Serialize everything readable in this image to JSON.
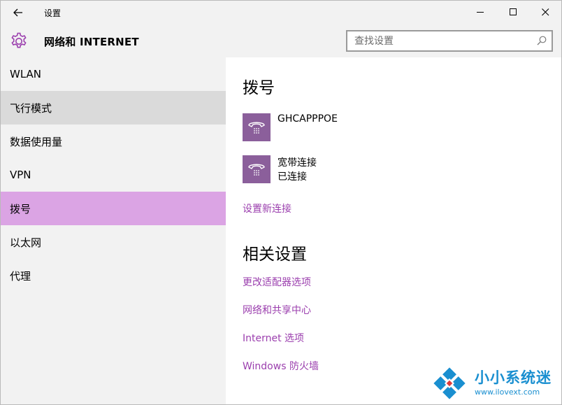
{
  "window": {
    "title": "设置",
    "minimize_icon": "minimize-icon",
    "maximize_icon": "maximize-icon",
    "close_icon": "close-icon"
  },
  "header": {
    "section_title": "网络和 INTERNET",
    "search_placeholder": "查找设置"
  },
  "sidebar": {
    "items": [
      {
        "label": "WLAN"
      },
      {
        "label": "飞行模式"
      },
      {
        "label": "数据使用量"
      },
      {
        "label": "VPN"
      },
      {
        "label": "拨号"
      },
      {
        "label": "以太网"
      },
      {
        "label": "代理"
      }
    ],
    "active_index": 4,
    "hover_index": 1
  },
  "main": {
    "dialup_heading": "拨号",
    "connections": [
      {
        "name": "GHCAPPPOE",
        "status": ""
      },
      {
        "name": "宽带连接",
        "status": "已连接"
      }
    ],
    "new_connection_link": "设置新连接",
    "related_heading": "相关设置",
    "related_links": [
      "更改适配器选项",
      "网络和共享中心",
      "Internet 选项",
      "Windows 防火墙"
    ]
  },
  "watermark": {
    "text": "小小系统迷",
    "url": "www.ilovext.com"
  },
  "colors": {
    "accent": "#9b3fae",
    "active_nav": "#dba4e4",
    "icon_tile": "#8b5f9b",
    "chrome": "#f2f2f2"
  }
}
